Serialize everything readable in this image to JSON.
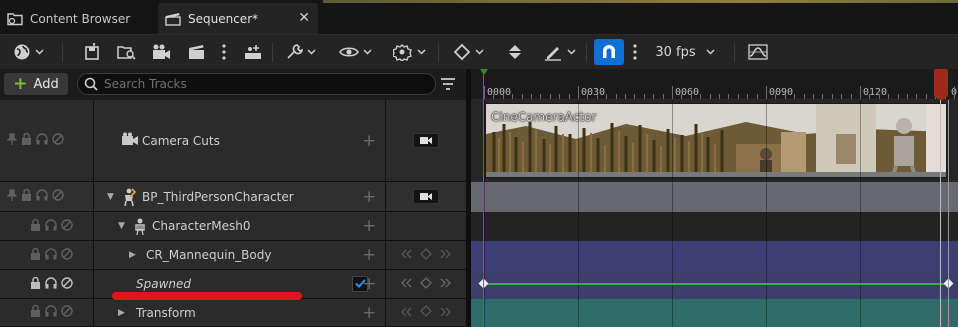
{
  "tabs": [
    {
      "label": "Content Browser",
      "active": false
    },
    {
      "label": "Sequencer*",
      "active": true
    }
  ],
  "toolbar": {
    "fps_label": "30 fps",
    "icons": [
      "world-icon",
      "save-icon",
      "find-asset-icon",
      "render-movie-icon",
      "clapboard-icon",
      "more-icon",
      "actions-icon",
      "tools-icon",
      "view-options-icon",
      "key-settings-icon",
      "keyframe-icon",
      "auto-key-icon",
      "curve-pen-icon",
      "snap-magnet-icon",
      "more-icon",
      "curve-editor-icon"
    ]
  },
  "outliner": {
    "add_label": "Add",
    "search_placeholder": "Search Tracks"
  },
  "tracks": [
    {
      "label": "Camera Cuts"
    },
    {
      "label": "BP_ThirdPersonCharacter"
    },
    {
      "label": "CharacterMesh0"
    },
    {
      "label": "CR_Mannequin_Body"
    },
    {
      "label": "Spawned",
      "checked": true
    },
    {
      "label": "Transform"
    }
  ],
  "timeline": {
    "ticks": [
      "0000",
      "0030",
      "0060",
      "0090",
      "0120",
      "0"
    ],
    "clip_label": "CineCameraActor"
  },
  "colors": {
    "accent": "#0d6fd8",
    "add_plus": "#78c03a",
    "annotation": "#e0151b",
    "playhead": "#9d2a1c",
    "bp_lane": "#686871",
    "cr_lane": "#3d3f74",
    "transform_lane": "#2f6b67"
  }
}
